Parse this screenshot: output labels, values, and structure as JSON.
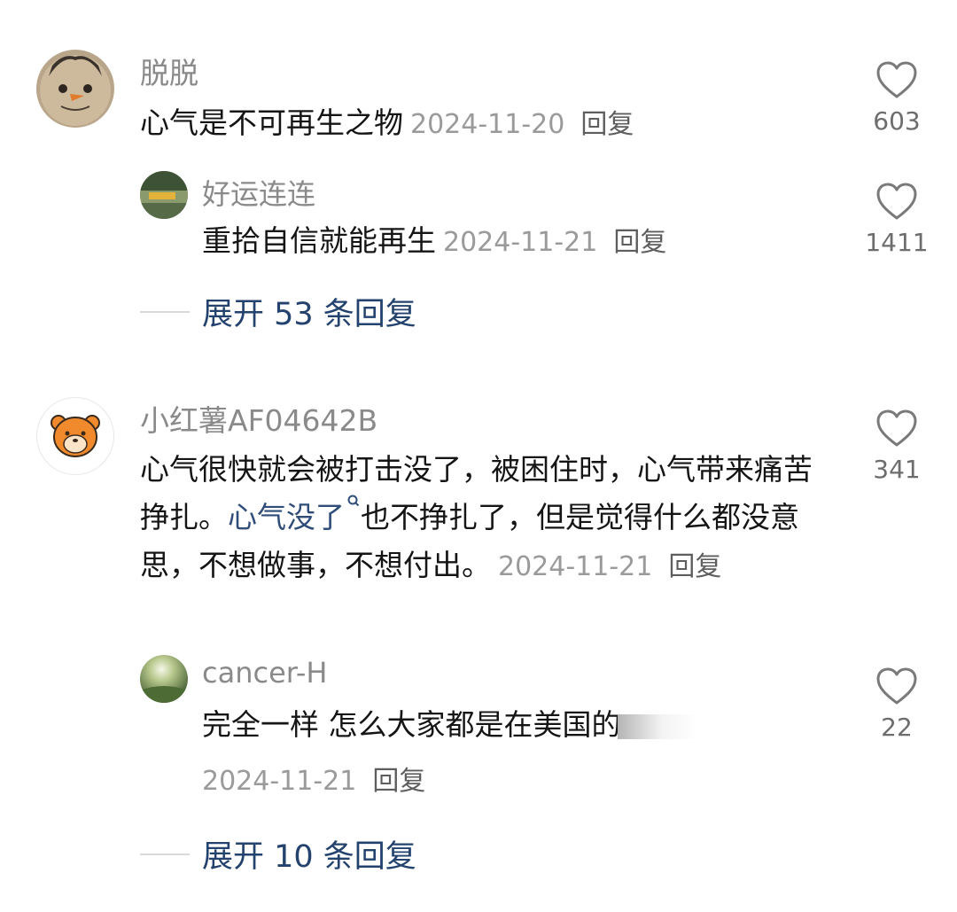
{
  "comments": [
    {
      "user": "脱脱",
      "text": "心气是不可再生之物",
      "date": "2024-11-20",
      "reply_label": "回复",
      "likes": "603",
      "replies": [
        {
          "user": "好运连连",
          "text": "重拾自信就能再生",
          "date": "2024-11-21",
          "reply_label": "回复",
          "likes": "1411"
        }
      ],
      "expand_label": "展开 53 条回复"
    },
    {
      "user": "小红薯AF04642B",
      "text_part1": "心气很快就会被打击没了，被困住时，心气带来痛苦挣扎。",
      "link_text": "心气没了",
      "text_part2": "也不挣扎了，但是觉得什么都没意思，不想做事，不想付出。",
      "date": "2024-11-21",
      "reply_label": "回复",
      "likes": "341",
      "replies": [
        {
          "user": "cancer-H",
          "text": "完全一样 怎么大家都是在美国的",
          "date": "2024-11-21",
          "reply_label": "回复",
          "likes": "22"
        }
      ],
      "expand_label": "展开 10 条回复"
    }
  ],
  "icons": {
    "like": "heart-outline-icon",
    "search": "search-mini-icon"
  },
  "colors": {
    "link": "#2f4d78",
    "expand": "#23426e",
    "meta": "#9a9a9a"
  }
}
